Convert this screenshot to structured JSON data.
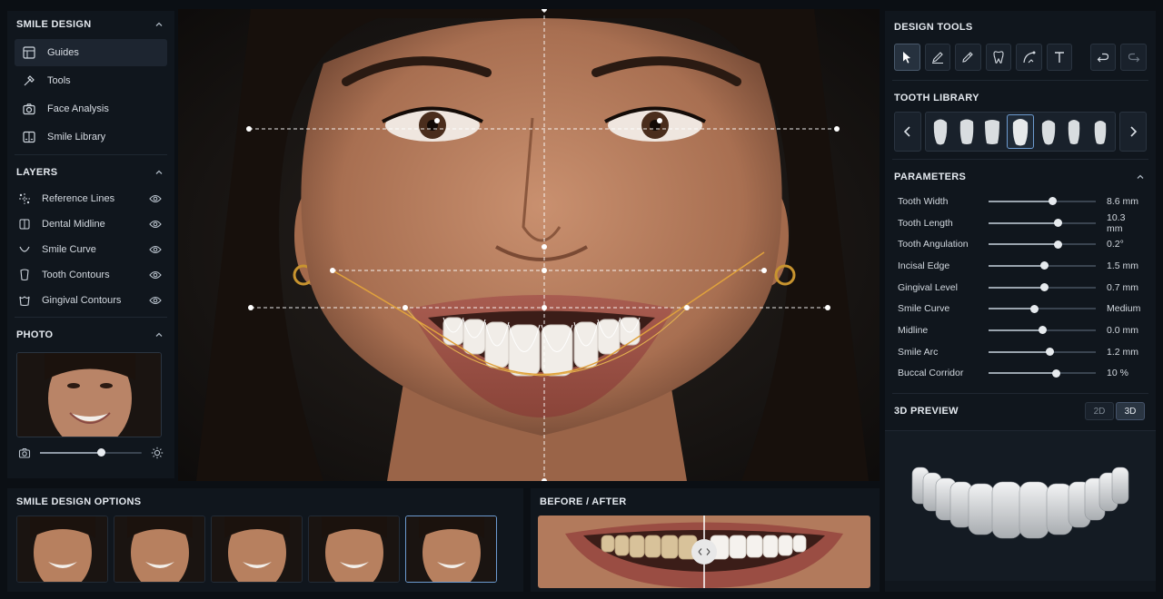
{
  "left": {
    "smile_design": {
      "title": "SMILE DESIGN",
      "items": [
        {
          "label": "Guides",
          "icon": "guides-icon",
          "active": true
        },
        {
          "label": "Tools",
          "icon": "tools-icon"
        },
        {
          "label": "Face Analysis",
          "icon": "camera-icon"
        },
        {
          "label": "Smile Library",
          "icon": "library-icon"
        }
      ]
    },
    "layers": {
      "title": "LAYERS",
      "items": [
        {
          "label": "Reference Lines"
        },
        {
          "label": "Dental Midline"
        },
        {
          "label": "Smile Curve"
        },
        {
          "label": "Tooth Contours"
        },
        {
          "label": "Gingival Contours"
        }
      ]
    },
    "photo": {
      "title": "PHOTO",
      "brightness": 0.6
    }
  },
  "bottom": {
    "options_title": "SMILE DESIGN OPTIONS",
    "before_after_title": "BEFORE / AFTER"
  },
  "right": {
    "design_tools_title": "DESIGN TOOLS",
    "tooth_library_title": "TOOTH LIBRARY",
    "parameters_title": "PARAMETERS",
    "parameters": [
      {
        "label": "Tooth Width",
        "value": "8.6 mm",
        "level": 0.6
      },
      {
        "label": "Tooth Length",
        "value": "10.3 mm",
        "level": 0.65
      },
      {
        "label": "Tooth Angulation",
        "value": "0.2°",
        "level": 0.65
      },
      {
        "label": "Incisal Edge",
        "value": "1.5 mm",
        "level": 0.52
      },
      {
        "label": "Gingival Level",
        "value": "0.7 mm",
        "level": 0.52
      },
      {
        "label": "Smile Curve",
        "value": "Medium",
        "level": 0.43
      },
      {
        "label": "Midline",
        "value": "0.0 mm",
        "level": 0.5
      },
      {
        "label": "Smile Arc",
        "value": "1.2 mm",
        "level": 0.57
      },
      {
        "label": "Buccal Corridor",
        "value": "10 %",
        "level": 0.63
      }
    ],
    "preview_title": "3D PREVIEW",
    "mode_2d": "2D",
    "mode_3d": "3D"
  },
  "colors": {
    "accent": "#6d9bd0",
    "guide_line": "#ffffff",
    "smile_curve": "#e0a23c"
  }
}
